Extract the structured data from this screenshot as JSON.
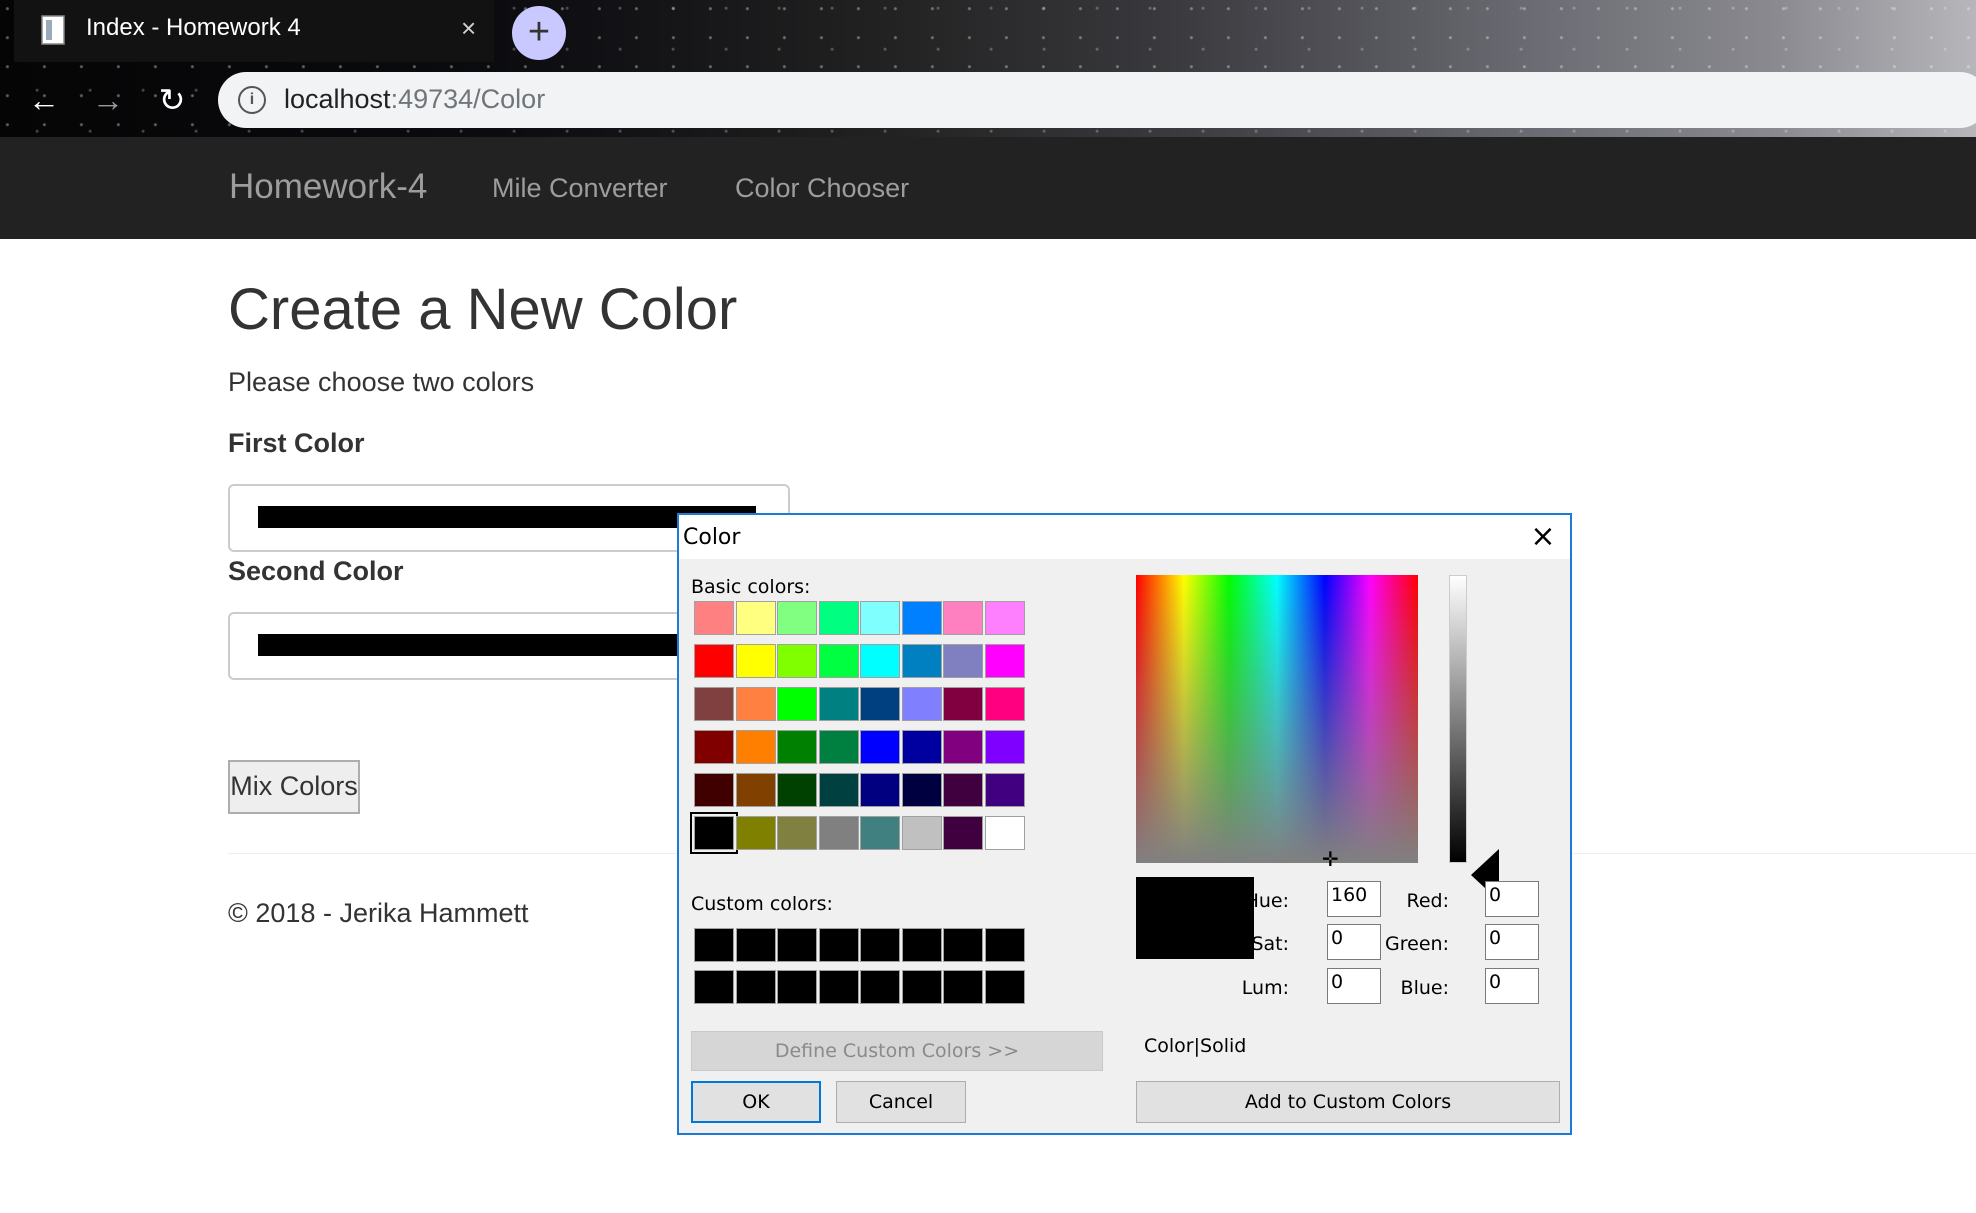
{
  "browser": {
    "tab_title": "Index - Homework 4",
    "tab_close": "×",
    "new_tab": "+",
    "url_host": "localhost",
    "url_rest": ":49734/Color",
    "back": "←",
    "forward": "→",
    "reload": "↻"
  },
  "navbar": {
    "brand": "Homework-4",
    "links": [
      "Mile Converter",
      "Color Chooser"
    ]
  },
  "page": {
    "heading": "Create a New Color",
    "intro": "Please choose two colors",
    "first_label": "First Color",
    "second_label": "Second Color",
    "first_value": "#000000",
    "second_value": "#000000",
    "mix_button": "Mix Colors",
    "footer": "© 2018 - Jerika Hammett"
  },
  "dialog": {
    "title": "Color",
    "close": "×",
    "basic_label": "Basic colors:",
    "basic_colors": [
      "#ff8080",
      "#ffff80",
      "#80ff80",
      "#00ff80",
      "#80ffff",
      "#0080ff",
      "#ff80c0",
      "#ff80ff",
      "#ff0000",
      "#ffff00",
      "#80ff00",
      "#00ff40",
      "#00ffff",
      "#0080c0",
      "#8080c0",
      "#ff00ff",
      "#804040",
      "#ff8040",
      "#00ff00",
      "#008080",
      "#004080",
      "#8080ff",
      "#800040",
      "#ff0080",
      "#800000",
      "#ff8000",
      "#008000",
      "#008040",
      "#0000ff",
      "#0000a0",
      "#800080",
      "#8000ff",
      "#400000",
      "#804000",
      "#004000",
      "#004040",
      "#000080",
      "#000040",
      "#400040",
      "#400080",
      "#000000",
      "#808000",
      "#808040",
      "#808080",
      "#408080",
      "#c0c0c0",
      "#400040",
      "#ffffff"
    ],
    "selected_basic_index": 40,
    "custom_label": "Custom colors:",
    "custom_colors": [
      "#000000",
      "#000000",
      "#000000",
      "#000000",
      "#000000",
      "#000000",
      "#000000",
      "#000000",
      "#000000",
      "#000000",
      "#000000",
      "#000000",
      "#000000",
      "#000000",
      "#000000",
      "#000000"
    ],
    "define_custom": "Define Custom Colors >>",
    "ok": "OK",
    "cancel": "Cancel",
    "color_solid_label": "Color|Solid",
    "hue_label": "Hue:",
    "sat_label": "Sat:",
    "lum_label": "Lum:",
    "red_label": "Red:",
    "green_label": "Green:",
    "blue_label": "Blue:",
    "hue": "160",
    "sat": "0",
    "lum": "0",
    "red": "0",
    "green": "0",
    "blue": "0",
    "add_custom": "Add to Custom Colors",
    "current_color": "#000000"
  }
}
